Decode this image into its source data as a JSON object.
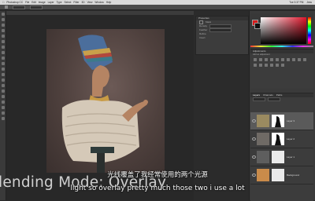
{
  "menubar": {
    "items": [
      "Photoshop CC",
      "File",
      "Edit",
      "Image",
      "Layer",
      "Type",
      "Select",
      "Filter",
      "3D",
      "View",
      "Window",
      "Help"
    ],
    "clock": "Tue 3:37 PM",
    "user": "Jess"
  },
  "properties": {
    "title": "Properties",
    "rows": [
      "Mask",
      "Density",
      "Feather",
      "Refine",
      "Invert"
    ]
  },
  "adjustments": {
    "title": "Adjustments",
    "subtitle": "Add an adjustment"
  },
  "layers": {
    "tabs": [
      "Layers",
      "Channels",
      "Paths"
    ],
    "rows": [
      {
        "name": "Layer 3",
        "thumb_color": "#9a8a60",
        "selected": true
      },
      {
        "name": "Layer 2",
        "thumb_color": "#6f6a65",
        "selected": false
      },
      {
        "name": "Layer 1",
        "thumb_color": "#5e5e5e",
        "selected": false
      },
      {
        "name": "Background",
        "thumb_color": "#c98b4a",
        "selected": false
      }
    ]
  },
  "colors": {
    "foreground": "#d81b1b",
    "background": "#111111"
  },
  "subtitles": {
    "chinese": "光线覆盖了我经常使用的两个光源",
    "english": "light so overlay pretty much those two i use a lot"
  },
  "caption": {
    "text": "lending Mode: Overlay"
  }
}
